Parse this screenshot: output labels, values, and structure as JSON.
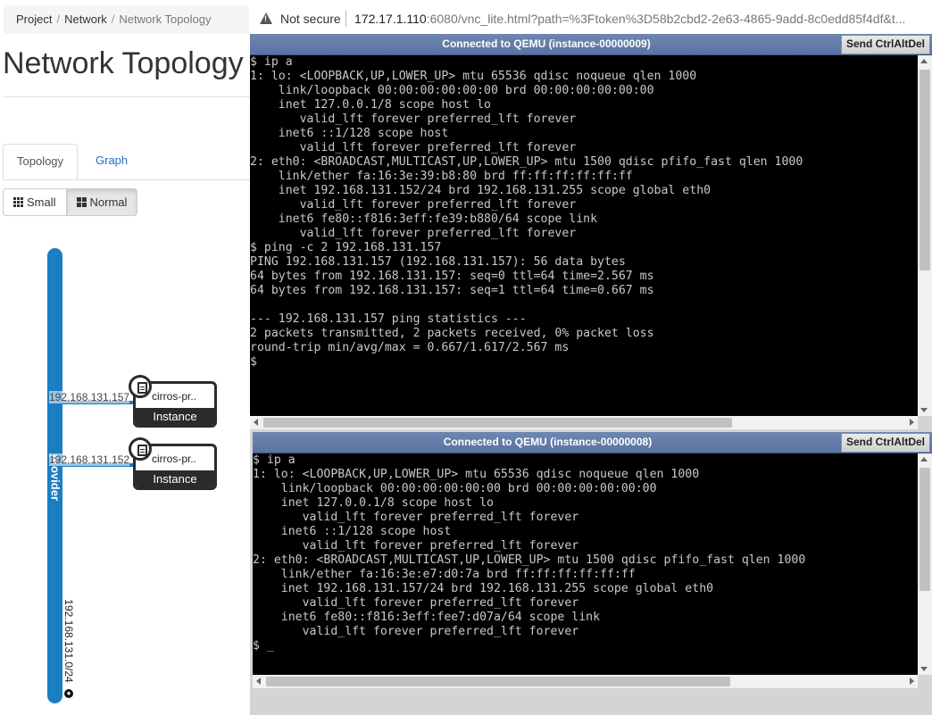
{
  "breadcrumb": {
    "items": [
      "Project",
      "Network"
    ],
    "current": "Network Topology"
  },
  "page": {
    "title": "Network Topology"
  },
  "tabs": [
    {
      "label": "Topology"
    },
    {
      "label": "Graph"
    }
  ],
  "view_toggle": {
    "small": "Small",
    "normal": "Normal"
  },
  "topology": {
    "network": {
      "name": "provider",
      "cidr": "192.168.131.0/24"
    },
    "instances": [
      {
        "name": "cirros-pr..",
        "type": "Instance",
        "ip": "192.168.131.157"
      },
      {
        "name": "cirros-pr..",
        "type": "Instance",
        "ip": "192.168.131.152"
      }
    ],
    "stub_label": "24",
    "colors": {
      "network": "#1c7ec2",
      "orange": "#f07f1c",
      "green": "#1aa73f"
    }
  },
  "browser": {
    "security": "Not secure",
    "url_host": "172.17.1.110",
    "url_rest": ":6080/vnc_lite.html?path=%3Ftoken%3D58b2cbd2-2e63-4865-9add-8c0edd85f4df&t..."
  },
  "consoles": [
    {
      "status": "Connected to QEMU (instance-00000009)",
      "cad_button": "Send CtrlAltDel",
      "lines": [
        "$ ip a",
        "1: lo: <LOOPBACK,UP,LOWER_UP> mtu 65536 qdisc noqueue qlen 1000",
        "    link/loopback 00:00:00:00:00:00 brd 00:00:00:00:00:00",
        "    inet 127.0.0.1/8 scope host lo",
        "       valid_lft forever preferred_lft forever",
        "    inet6 ::1/128 scope host",
        "       valid_lft forever preferred_lft forever",
        "2: eth0: <BROADCAST,MULTICAST,UP,LOWER_UP> mtu 1500 qdisc pfifo_fast qlen 1000",
        "    link/ether fa:16:3e:39:b8:80 brd ff:ff:ff:ff:ff:ff",
        "    inet 192.168.131.152/24 brd 192.168.131.255 scope global eth0",
        "       valid_lft forever preferred_lft forever",
        "    inet6 fe80::f816:3eff:fe39:b880/64 scope link",
        "       valid_lft forever preferred_lft forever",
        "$ ping -c 2 192.168.131.157",
        "PING 192.168.131.157 (192.168.131.157): 56 data bytes",
        "64 bytes from 192.168.131.157: seq=0 ttl=64 time=2.567 ms",
        "64 bytes from 192.168.131.157: seq=1 ttl=64 time=0.667 ms",
        "",
        "--- 192.168.131.157 ping statistics ---",
        "2 packets transmitted, 2 packets received, 0% packet loss",
        "round-trip min/avg/max = 0.667/1.617/2.567 ms",
        "$ "
      ]
    },
    {
      "status": "Connected to QEMU (instance-00000008)",
      "cad_button": "Send CtrlAltDel",
      "lines": [
        "$ ip a",
        "1: lo: <LOOPBACK,UP,LOWER_UP> mtu 65536 qdisc noqueue qlen 1000",
        "    link/loopback 00:00:00:00:00:00 brd 00:00:00:00:00:00",
        "    inet 127.0.0.1/8 scope host lo",
        "       valid_lft forever preferred_lft forever",
        "    inet6 ::1/128 scope host",
        "       valid_lft forever preferred_lft forever",
        "2: eth0: <BROADCAST,MULTICAST,UP,LOWER_UP> mtu 1500 qdisc pfifo_fast qlen 1000",
        "    link/ether fa:16:3e:e7:d0:7a brd ff:ff:ff:ff:ff:ff",
        "    inet 192.168.131.157/24 brd 192.168.131.255 scope global eth0",
        "       valid_lft forever preferred_lft forever",
        "    inet6 fe80::f816:3eff:fee7:d07a/64 scope link",
        "       valid_lft forever preferred_lft forever",
        "$ _"
      ]
    }
  ]
}
